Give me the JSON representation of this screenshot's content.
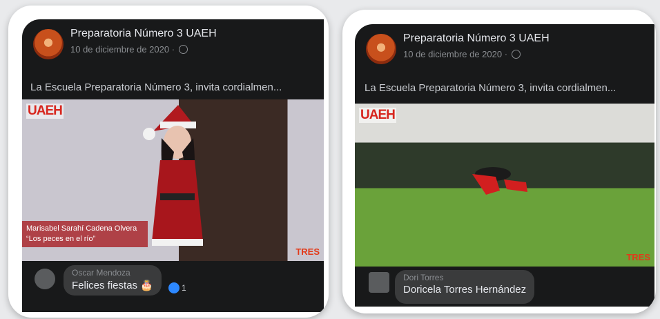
{
  "posts": [
    {
      "page_name": "Preparatoria Número 3 UAEH",
      "date": "10 de diciembre de 2020 ·",
      "text": "La Escuela Preparatoria Número 3, invita cordialmen...",
      "video": {
        "logo": "UAEH",
        "watermark": "TRES",
        "caption_name": "Marisabel Sarahí Cadena Olvera",
        "caption_title": "“Los peces en el río”"
      },
      "comment": {
        "author": "Oscar Mendoza",
        "text": "Felices fiestas 🎂",
        "likes": "1"
      }
    },
    {
      "page_name": "Preparatoria Número 3 UAEH",
      "date": "10 de diciembre de 2020 ·",
      "text": "La Escuela Preparatoria Número 3, invita cordialmen...",
      "video": {
        "logo": "UAEH",
        "watermark": "TRES"
      },
      "comment": {
        "author": "Dori Torres",
        "text": "Doricela Torres Hernández"
      }
    }
  ],
  "icons": [
    "avatar",
    "globe-icon",
    "like-icon"
  ]
}
